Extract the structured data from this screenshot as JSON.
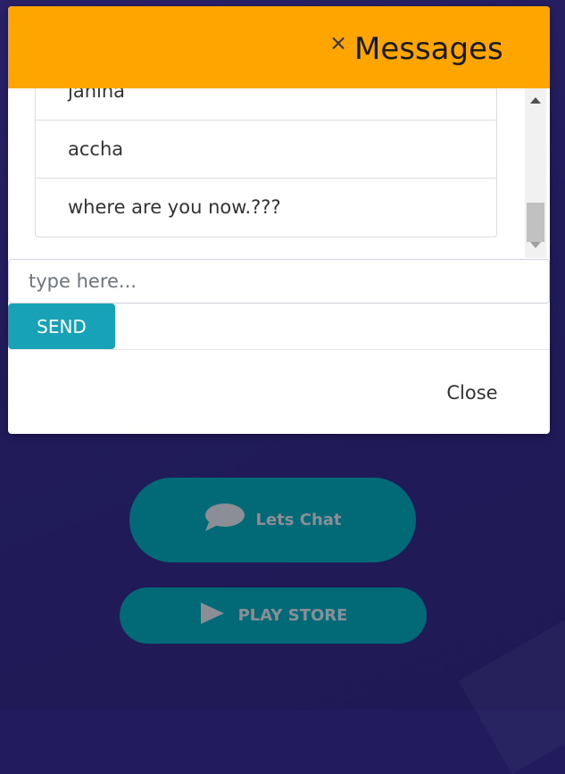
{
  "modal": {
    "title": "Messages",
    "close_glyph": "×",
    "messages": [
      "janina",
      "accha",
      "where are you now.???"
    ],
    "input_placeholder": "type here...",
    "send_label": "SEND",
    "close_label": "Close"
  },
  "page": {
    "chat_button_label": "Lets Chat",
    "chat_icon": "chat-bubble-icon",
    "store_button_label": "PLAY STORE",
    "store_icon": "play-icon"
  },
  "colors": {
    "header": "#fea500",
    "send_button": "#17a2b8",
    "page_background": "#221c5c",
    "page_buttons": "#016a76"
  }
}
